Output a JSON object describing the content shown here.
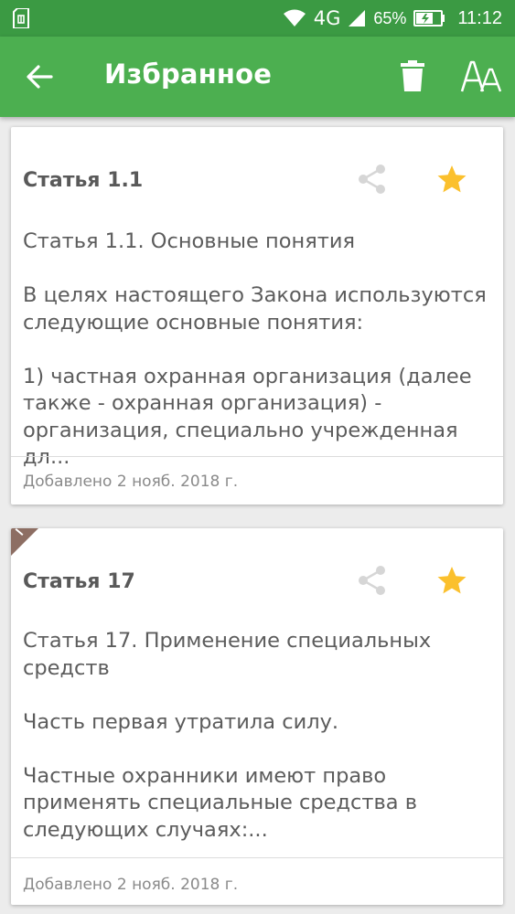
{
  "status": {
    "network": "4G",
    "battery": "65%",
    "time": "11:12"
  },
  "appbar": {
    "title": "Избранное"
  },
  "colors": {
    "status_bar": "#3b9a43",
    "app_bar": "#4caf50",
    "star": "#fbc02d",
    "corner_tag": "#8d6e63"
  },
  "cards": [
    {
      "heading": "Статья 1.1",
      "lines": [
        "Статья 1.1. Основные понятия",
        "В целях настоящего Закона используются следующие основные понятия:",
        "1) частная охранная организация (далее также - охранная организация) - организация, специально учрежденная дл..."
      ],
      "date": "Добавлено 2 нояб. 2018 г."
    },
    {
      "heading": "Статья 17",
      "lines": [
        "Статья 17. Применение специальных средств",
        "Часть первая утратила силу.",
        "Частные охранники имеют право применять специальные средства в следующих случаях:..."
      ],
      "date": "Добавлено 2 нояб. 2018 г."
    }
  ]
}
